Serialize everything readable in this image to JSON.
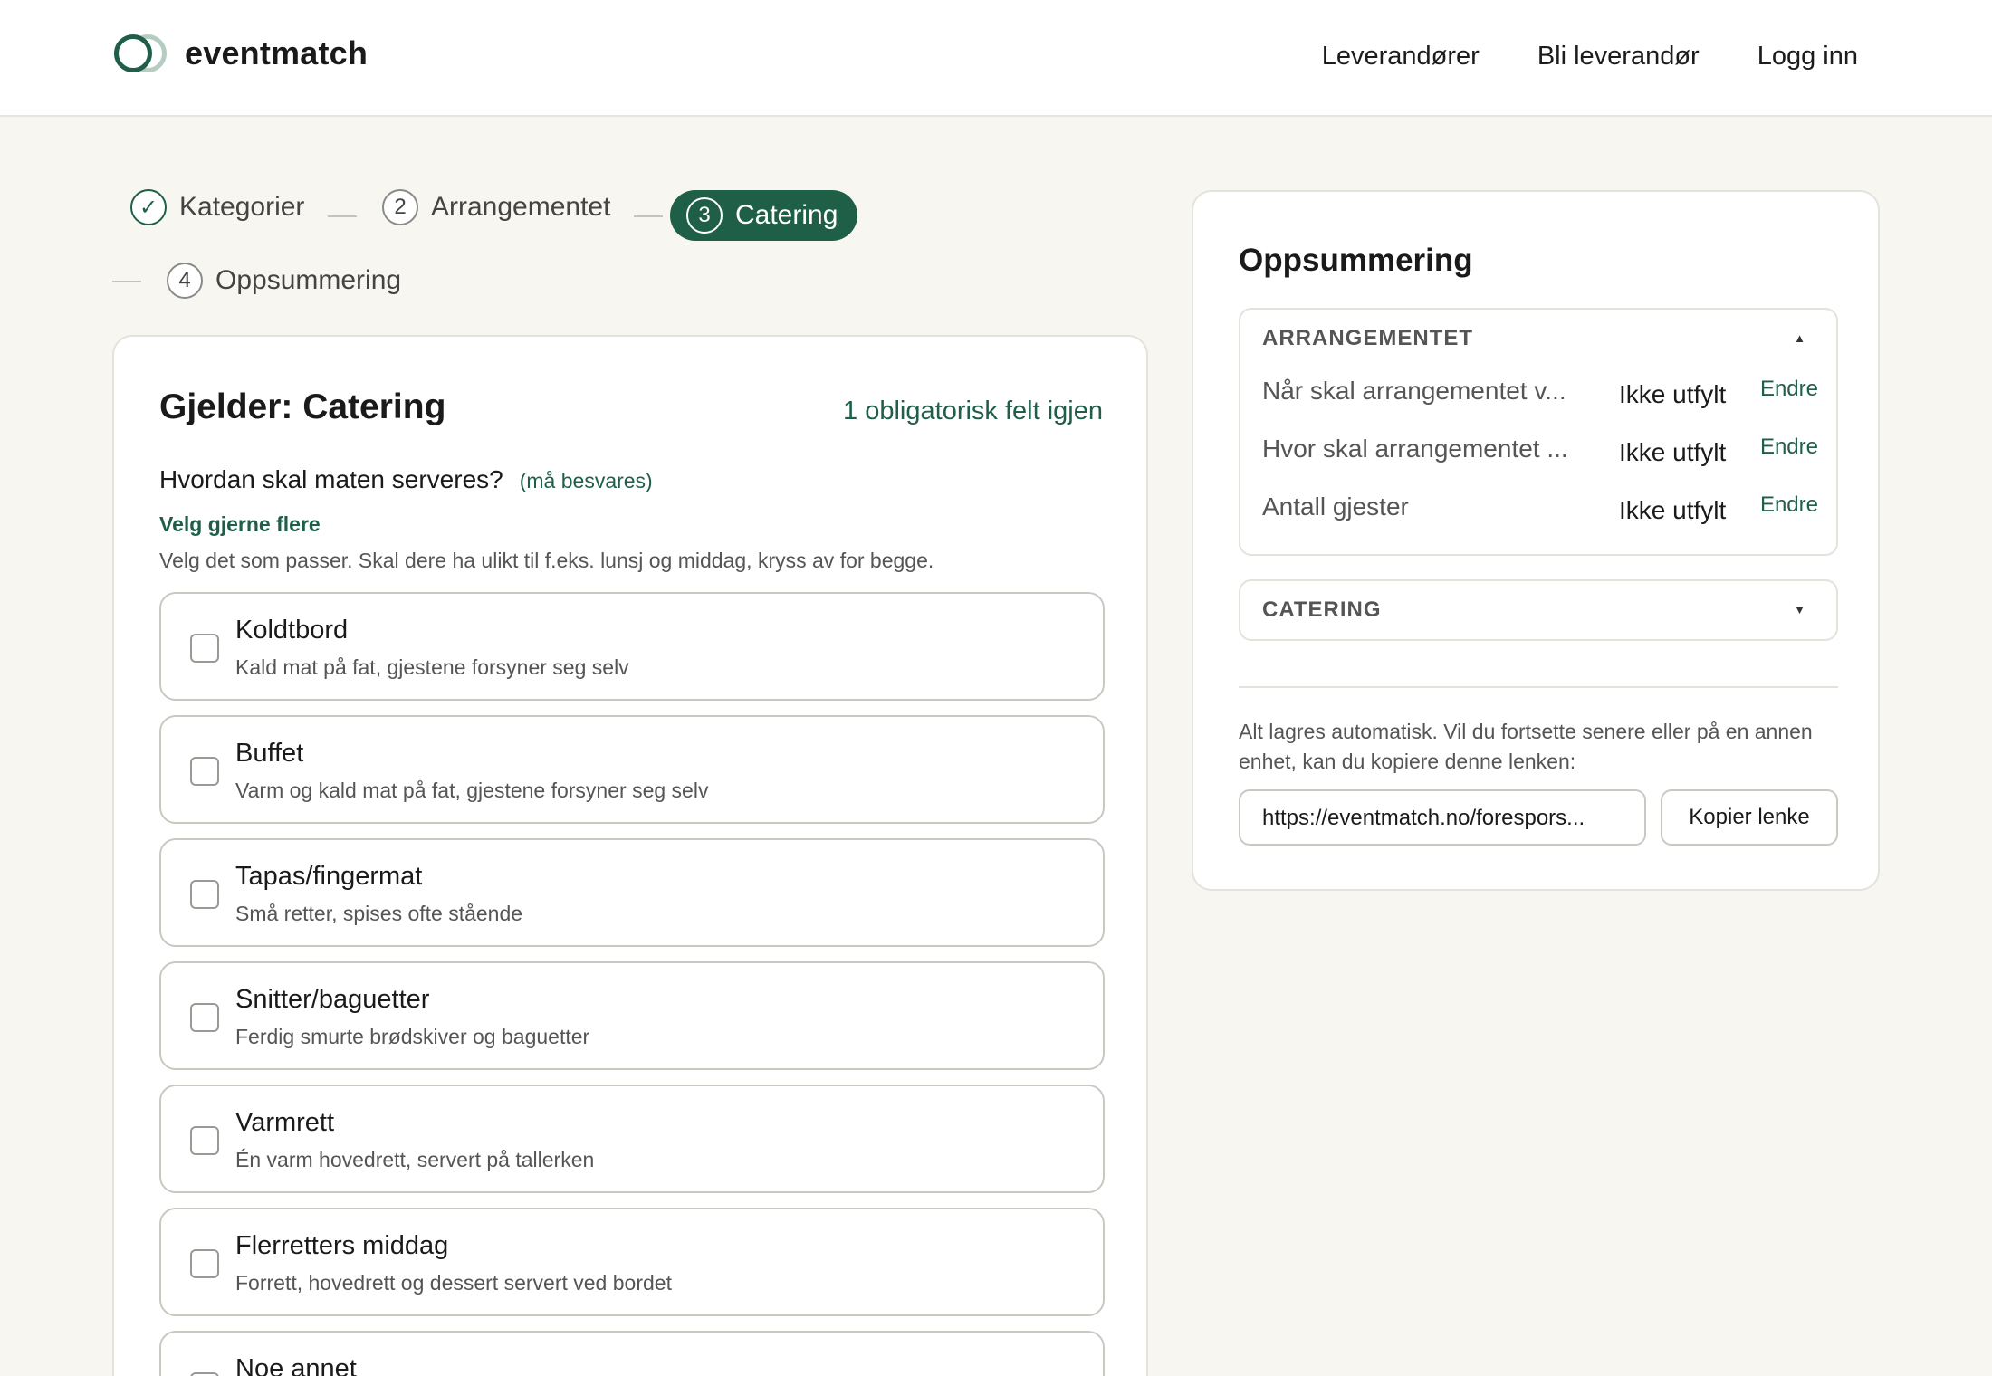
{
  "header": {
    "logo_text": "eventmatch",
    "nav": [
      "Leverandører",
      "Bli leverandør",
      "Logg inn"
    ]
  },
  "stepper": {
    "steps": [
      {
        "num": "✓",
        "label": "Kategorier",
        "state": "done"
      },
      {
        "num": "2",
        "label": "Arrangementet",
        "state": "pending"
      },
      {
        "num": "3",
        "label": "Catering",
        "state": "active"
      },
      {
        "num": "4",
        "label": "Oppsummering",
        "state": "pending"
      }
    ]
  },
  "form": {
    "title": "Gjelder: Catering",
    "required_left": "1 obligatorisk felt igjen",
    "question": "Hvordan skal maten serveres?",
    "must_answer": "(må besvares)",
    "multi_hint": "Velg gjerne flere",
    "hint": "Velg det som passer. Skal dere ha ulikt til f.eks. lunsj og middag, kryss av for begge.",
    "options": [
      {
        "label": "Koldtbord",
        "desc": "Kald mat på fat, gjestene forsyner seg selv",
        "checked": false
      },
      {
        "label": "Buffet",
        "desc": "Varm og kald mat på fat, gjestene forsyner seg selv",
        "checked": false
      },
      {
        "label": "Tapas/fingermat",
        "desc": "Små retter, spises ofte stående",
        "checked": false
      },
      {
        "label": "Snitter/baguetter",
        "desc": "Ferdig smurte brødskiver og baguetter",
        "checked": false
      },
      {
        "label": "Varmrett",
        "desc": "Én varm hovedrett, servert på tallerken",
        "checked": false
      },
      {
        "label": "Flerretters middag",
        "desc": "Forrett, hovedrett og dessert servert ved bordet",
        "checked": false
      },
      {
        "label": "Noe annet",
        "desc": "",
        "checked": false
      }
    ]
  },
  "summary": {
    "title": "Oppsummering",
    "sections": [
      {
        "heading": "ARRANGEMENTET",
        "caret": "▲",
        "rows": [
          {
            "question": "Når skal arrangementet v...",
            "value": "Ikke utfylt",
            "edit": "Endre"
          },
          {
            "question": "Hvor skal arrangementet ...",
            "value": "Ikke utfylt",
            "edit": "Endre"
          },
          {
            "question": "Antall gjester",
            "value": "Ikke utfylt",
            "edit": "Endre"
          }
        ]
      },
      {
        "heading": "CATERING",
        "caret": "▼",
        "rows": []
      }
    ],
    "autosave_text": "Alt lagres automatisk. Vil du fortsette senere eller på en annen enhet, kan du kopiere denne lenken:",
    "link_value": "https://eventmatch.no/forespors...",
    "copy_label": "Kopier lenke"
  },
  "colors": {
    "accent": "#1f5f48",
    "background": "#f7f6f0"
  }
}
